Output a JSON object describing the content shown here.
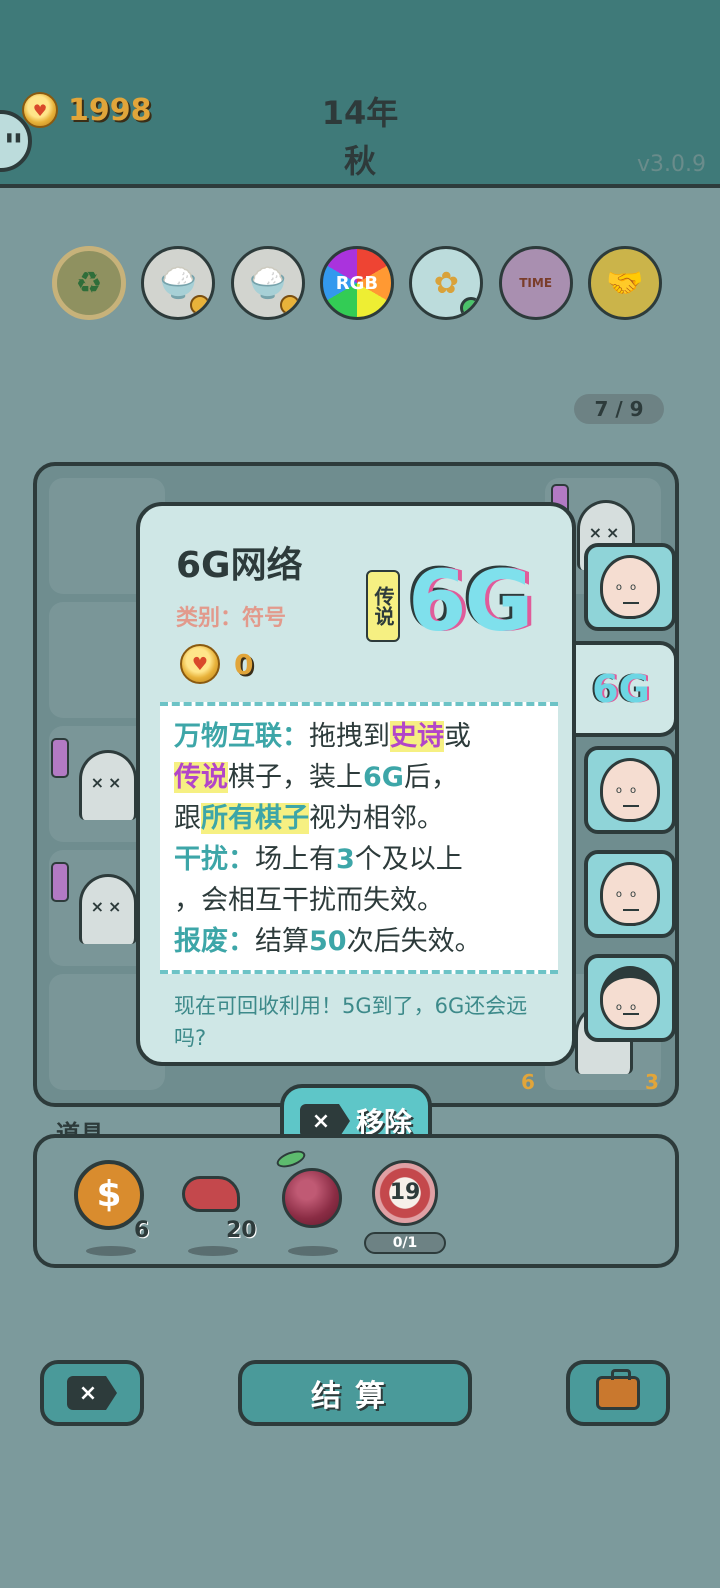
{
  "header": {
    "coins": "1998",
    "year": "14年",
    "season": "秋",
    "version": "v3.0.9"
  },
  "relics": [
    {
      "name": "recycle-icon",
      "label": "♻"
    },
    {
      "name": "rice-bowl-icon",
      "label": "🍚"
    },
    {
      "name": "rice-bowl-icon",
      "label": "🍚"
    },
    {
      "name": "rgb-icon",
      "label": "RGB"
    },
    {
      "name": "flower-pot-icon",
      "label": "✿"
    },
    {
      "name": "time-magazine-icon",
      "label": "TIME"
    },
    {
      "name": "handshake-icon",
      "label": "🤝"
    }
  ],
  "board": {
    "counter": "7 / 9",
    "cell_numbers": [
      "6",
      "3"
    ]
  },
  "card": {
    "title": "6G网络",
    "category": "类别：符号",
    "cost": "0",
    "rarity": "传说",
    "icon_text": "6G",
    "desc": {
      "l1_key": "万物互联：",
      "l1_a": "拖拽到",
      "l1_hl": "史诗",
      "l1_b": "或",
      "l2_hl": "传说",
      "l2_a": "棋子，装上",
      "l2_num": "6G",
      "l2_b": "后，",
      "l3_a": "跟",
      "l3_hl": "所有棋子",
      "l3_b": "视为相邻。",
      "l4_key": "干扰：",
      "l4_a": "场上有",
      "l4_num": "3",
      "l4_b": "个及以上",
      "l5": "，会相互干扰而失效。",
      "l6_key": "报废：",
      "l6_a": "结算",
      "l6_num": "50",
      "l6_b": "次后失效。"
    },
    "flavor": "现在可回收利用！5G到了，6G还会远吗?"
  },
  "tab_6g": "6G",
  "remove_button": "移除",
  "items": {
    "label": "道具",
    "counts": {
      "dollar": "6",
      "liver": "20"
    },
    "target_value": "19",
    "target_progress": "0/1"
  },
  "bottom": {
    "settle": "结算"
  },
  "colors": {
    "accent": "#3da6a8",
    "highlight": "#f6f082",
    "epic": "#b245c9",
    "gold": "#e1a53a"
  }
}
